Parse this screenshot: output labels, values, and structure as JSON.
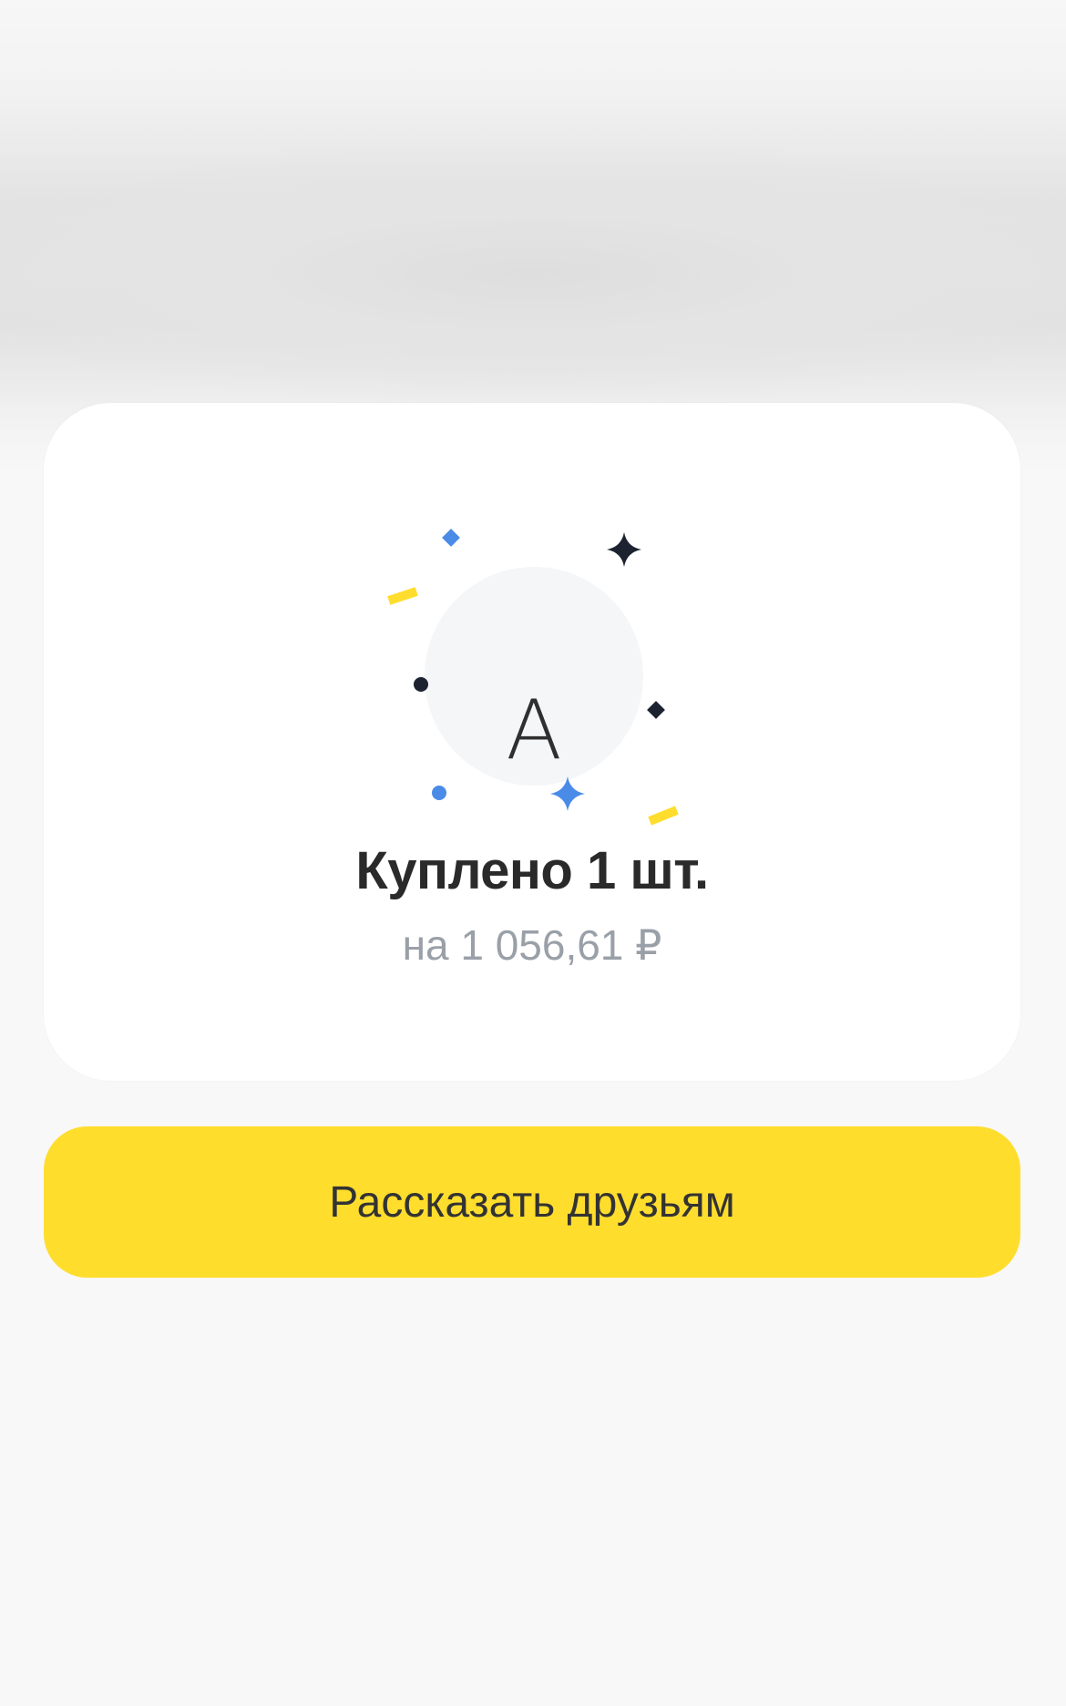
{
  "purchase_card": {
    "avatar_letter": "А",
    "title": "Куплено 1 шт.",
    "subtitle": "на 1 056,61 ₽"
  },
  "actions": {
    "share_label": "Рассказать друзьям"
  },
  "colors": {
    "accent_yellow": "#ffdd2d",
    "confetti_blue": "#4a8be8",
    "confetti_dark": "#1c2230",
    "avatar_bg": "#f5f6f8",
    "page_bg": "#f8f8f8"
  }
}
